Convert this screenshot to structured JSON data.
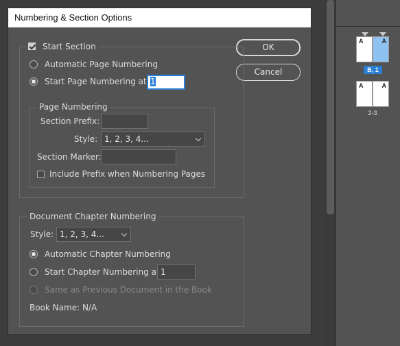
{
  "dialog": {
    "title": "Numbering & Section Options",
    "ok_label": "OK",
    "cancel_label": "Cancel",
    "start_section": {
      "label": "Start Section",
      "checked": true
    },
    "automatic_page_numbering": {
      "label": "Automatic Page Numbering",
      "selected": false
    },
    "start_page_numbering": {
      "label": "Start Page Numbering at:",
      "selected": true,
      "value": "1"
    },
    "page_numbering": {
      "title": "Page Numbering",
      "section_prefix_label": "Section Prefix:",
      "section_prefix_value": "",
      "style_label": "Style:",
      "style_value": "1, 2, 3, 4...",
      "section_marker_label": "Section Marker:",
      "section_marker_value": "",
      "include_prefix": {
        "label": "Include Prefix when Numbering Pages",
        "checked": false
      }
    },
    "chapter_numbering": {
      "title": "Document Chapter Numbering",
      "style_label": "Style:",
      "style_value": "1, 2, 3, 4...",
      "automatic_label": "Automatic Chapter Numbering",
      "automatic_selected": true,
      "start_label": "Start Chapter Numbering at:",
      "start_value": "1",
      "same_as_previous_label": "Same as Previous Document in the Book",
      "book_name": "Book Name: N/A"
    }
  },
  "pages_panel": {
    "spread1": {
      "left_master": "A",
      "right_master": "A",
      "section_badge": "B, 1"
    },
    "spread2": {
      "left_master": "A",
      "right_master": "A",
      "label": "2-3"
    },
    "colors": {
      "selected_page": "#8ec2f0",
      "badge": "#2a7fd4",
      "focus": "#2a7fd4"
    }
  }
}
